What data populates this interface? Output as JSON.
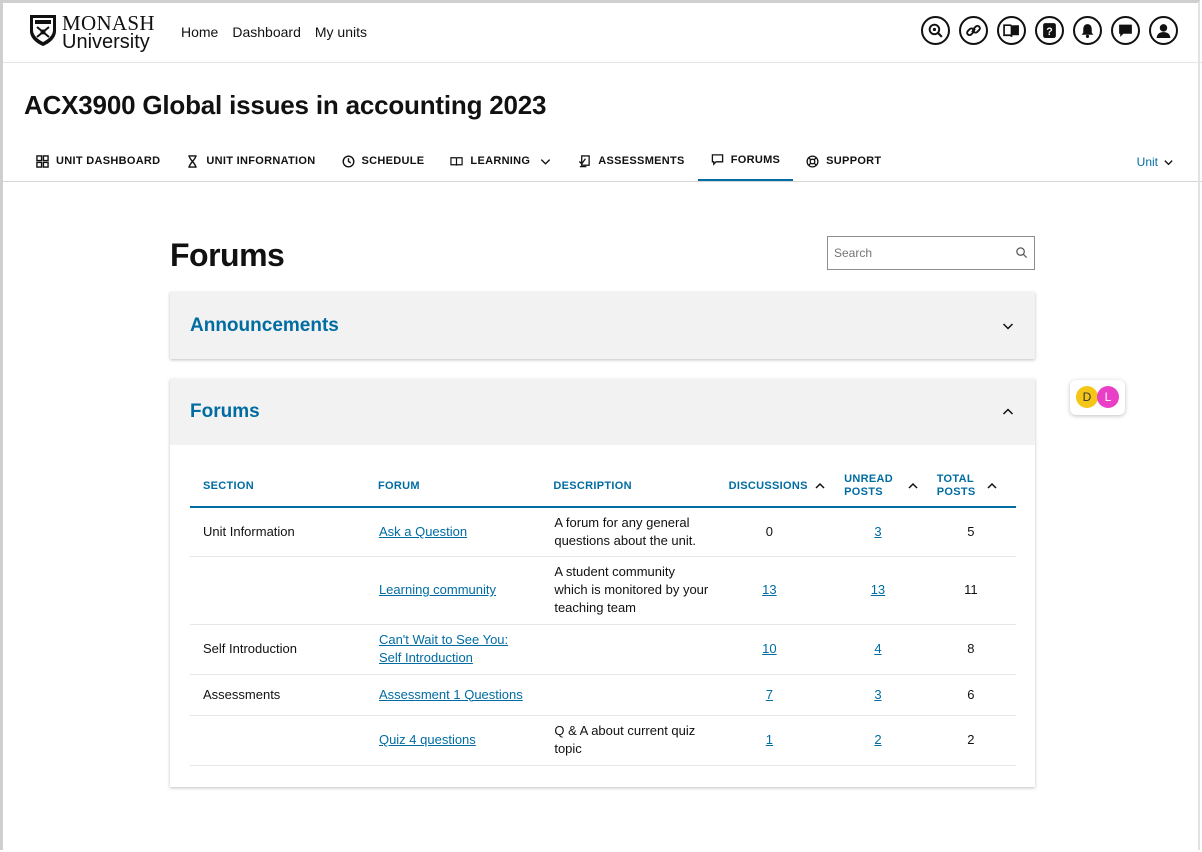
{
  "logo": {
    "line1": "MONASH",
    "line2": "University"
  },
  "mainnav": [
    "Home",
    "Dashboard",
    "My units"
  ],
  "topicons": [
    "accessibility-icon",
    "link-icon",
    "book-icon",
    "help-icon",
    "bell-icon",
    "chat-icon",
    "profile-icon"
  ],
  "unit_title": "ACX3900 Global issues in accounting 2023",
  "tabs": [
    {
      "label": "UNIT DASHBOARD",
      "icon": "grid-icon"
    },
    {
      "label": "UNIT INFORNATION",
      "icon": "hourglass-icon"
    },
    {
      "label": "SCHEDULE",
      "icon": "clock-icon"
    },
    {
      "label": "LEARNING",
      "icon": "book-open-icon"
    },
    {
      "label": "ASSESSMENTS",
      "icon": "assessment-icon"
    },
    {
      "label": "FORUMS",
      "icon": "forum-icon",
      "active": true
    },
    {
      "label": "SUPPORT",
      "icon": "lifebuoy-icon"
    }
  ],
  "unit_dropdown": "Unit",
  "page_title": "Forums",
  "search": {
    "placeholder": "Search"
  },
  "panels": {
    "announcements": {
      "title": "Announcements",
      "expanded": false
    },
    "forums": {
      "title": "Forums",
      "expanded": true
    }
  },
  "table": {
    "headers": {
      "section": "SECTION",
      "forum": "FORUM",
      "description": "DESCRIPTION",
      "discussions": "DISCUSSIONS",
      "unread_1": "UNREAD",
      "unread_2": "POSTS",
      "total_1": "TOTAL",
      "total_2": "POSTS"
    },
    "rows": [
      {
        "section": "Unit Information",
        "forum": "Ask a Question",
        "description": "A forum for any general questions about the unit.",
        "discussions": "0",
        "unread": "3",
        "total": "5"
      },
      {
        "section": "",
        "forum": "Learning community",
        "description": "A student community which is monitored by your teaching team",
        "discussions": "13",
        "unread": "13",
        "total": "11"
      },
      {
        "section": "Self Introduction",
        "forum": "Can't Wait to See You: Self Introduction",
        "description": "",
        "discussions": "10",
        "unread": "4",
        "total": "8"
      },
      {
        "section": "Assessments",
        "forum": "Assessment 1 Questions",
        "description": "",
        "discussions": "7",
        "unread": "3",
        "total": "6"
      },
      {
        "section": "",
        "forum": "Quiz 4 questions",
        "description": "Q & A about current quiz topic",
        "discussions": "1",
        "unread": "2",
        "total": "2"
      }
    ]
  },
  "presence": {
    "users": [
      {
        "initial": "D",
        "color": "#f5c518"
      },
      {
        "initial": "L",
        "color": "#e83fc6"
      }
    ]
  },
  "colors": {
    "accent": "#006ca2",
    "panel_bg": "#f2f2f2"
  }
}
